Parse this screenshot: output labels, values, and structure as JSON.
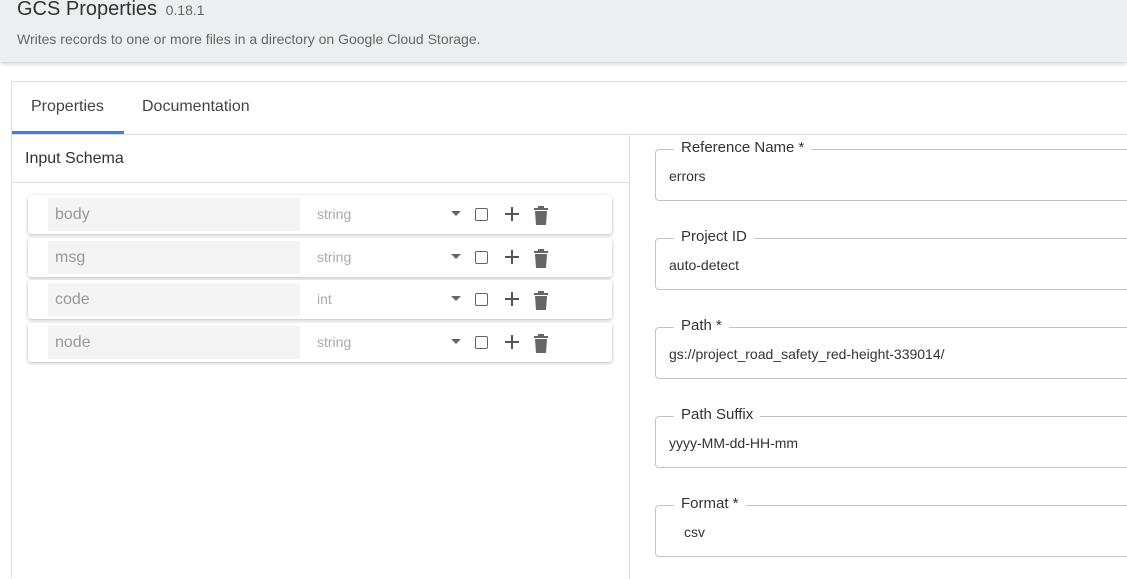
{
  "header": {
    "title": "GCS Properties",
    "version": "0.18.1",
    "description": "Writes records to one or more files in a directory on Google Cloud Storage."
  },
  "tabs": [
    {
      "label": "Properties",
      "active": true
    },
    {
      "label": "Documentation",
      "active": false
    }
  ],
  "schema": {
    "title": "Input Schema",
    "fields": [
      {
        "name": "body",
        "type": "string"
      },
      {
        "name": "msg",
        "type": "string"
      },
      {
        "name": "code",
        "type": "int"
      },
      {
        "name": "node",
        "type": "string"
      }
    ]
  },
  "properties": [
    {
      "label": "Reference Name  *",
      "value": "errors"
    },
    {
      "label": "Project ID",
      "value": "auto-detect"
    },
    {
      "label": "Path  *",
      "value": "gs://project_road_safety_red-height-339014/"
    },
    {
      "label": "Path Suffix",
      "value": "yyyy-MM-dd-HH-mm"
    },
    {
      "label": "Format  *",
      "value": "csv"
    }
  ],
  "colors": {
    "accent": "#3f7ee0",
    "header_bg": "#eceef2"
  }
}
